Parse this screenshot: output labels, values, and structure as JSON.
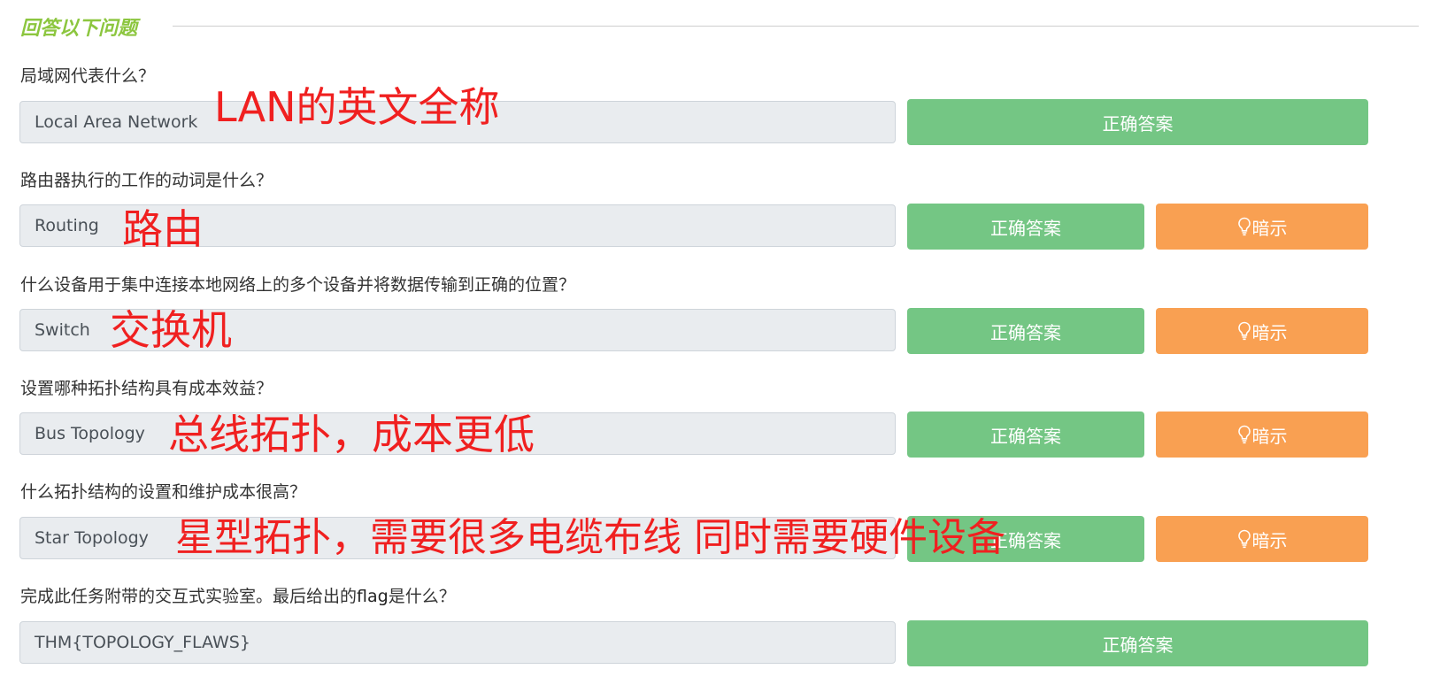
{
  "section": {
    "title": "回答以下问题"
  },
  "questions": [
    {
      "prompt": "局域网代表什么？",
      "answer": "Local Area Network",
      "correct_label": "正确答案",
      "annotation": "LAN的英文全称"
    },
    {
      "prompt": "路由器执行的工作的动词是什么？",
      "answer": "Routing",
      "correct_label": "正确答案",
      "hint_label": "暗示",
      "annotation": "路由"
    },
    {
      "prompt": "什么设备用于集中连接本地网络上的多个设备并将数据传输到正确的位置？",
      "answer": "Switch",
      "correct_label": "正确答案",
      "hint_label": "暗示",
      "annotation": "交换机"
    },
    {
      "prompt": "设置哪种拓扑结构具有成本效益？",
      "answer": "Bus Topology",
      "correct_label": "正确答案",
      "hint_label": "暗示",
      "annotation": "总线拓扑，成本更低"
    },
    {
      "prompt": "什么拓扑结构的设置和维护成本很高？",
      "answer": "Star Topology",
      "correct_label": "正确答案",
      "hint_label": "暗示",
      "annotation": "星型拓扑，需要很多电缆布线 同时需要硬件设备"
    },
    {
      "prompt_before": "完成此任务附带的交互式实验室。最后给出的",
      "prompt_flag": "flag",
      "prompt_after": "是什么？",
      "answer": "THM{TOPOLOGY_FLAWS}",
      "correct_label": "正确答案"
    }
  ],
  "colors": {
    "section_title": "#8cc63f",
    "correct_button": "#74c684",
    "hint_button": "#f9a052",
    "annotation": "#f02020",
    "answer_background": "#e9ecef"
  },
  "icons": {
    "hint": "lightbulb-icon"
  }
}
